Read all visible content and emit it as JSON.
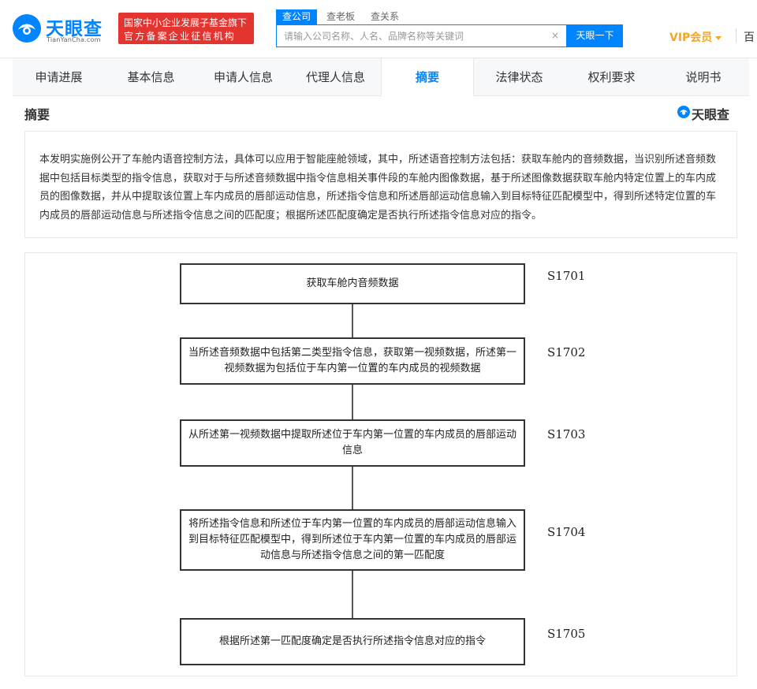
{
  "header": {
    "logo_text": "天眼查",
    "logo_sub": "TianYanCha.com",
    "gov_badge_line1": "国家中小企业发展子基金旗下",
    "gov_badge_line2": "官方备案企业征信机构",
    "search_tabs": [
      "查公司",
      "查老板",
      "查关系"
    ],
    "search_placeholder": "请输入公司名称、人名、品牌名称等关键词",
    "search_clear": "×",
    "search_button": "天眼一下",
    "vip_label": "VIP会员",
    "more_label": "百",
    "accent_color": "#0084ff",
    "badge_color": "#e3342f",
    "vip_color": "#f5a623"
  },
  "nav": {
    "items": [
      "申请进展",
      "基本信息",
      "申请人信息",
      "代理人信息",
      "摘要",
      "法律状态",
      "权利要求",
      "说明书"
    ],
    "active": "摘要"
  },
  "section": {
    "title": "摘要",
    "watermark": "天眼查"
  },
  "abstract": {
    "text": "本发明实施例公开了车舱内语音控制方法，具体可以应用于智能座舱领域，其中，所述语音控制方法包括：获取车舱内的音频数据，当识别所述音频数据中包括目标类型的指令信息，获取对于与所述音频数据中指令信息相关事件段的车舱内图像数据，基于所述图像数据获取车舱内特定位置上的车内成员的图像数据，并从中提取该位置上车内成员的唇部运动信息，所述指令信息和所述唇部运动信息输入到目标特征匹配模型中，得到所述特定位置的车内成员的唇部运动信息与所述指令信息之间的匹配度；根据所述匹配度确定是否执行所述指令信息对应的指令。"
  },
  "flowchart": {
    "steps": [
      {
        "label": "S1701",
        "text": "获取车舱内音频数据"
      },
      {
        "label": "S1702",
        "text": "当所述音频数据中包括第二类型指令信息，获取第一视频数据，所述第一视频数据为包括位于车内第一位置的车内成员的视频数据"
      },
      {
        "label": "S1703",
        "text": "从所述第一视频数据中提取所述位于车内第一位置的车内成员的唇部运动信息"
      },
      {
        "label": "S1704",
        "text": "将所述指令信息和所述位于车内第一位置的车内成员的唇部运动信息输入到目标特征匹配模型中，得到所述位于车内第一位置的车内成员的唇部运动信息与所述指令信息之间的第一匹配度"
      },
      {
        "label": "S1705",
        "text": "根据所述第一匹配度确定是否执行所述指令信息对应的指令"
      }
    ]
  }
}
